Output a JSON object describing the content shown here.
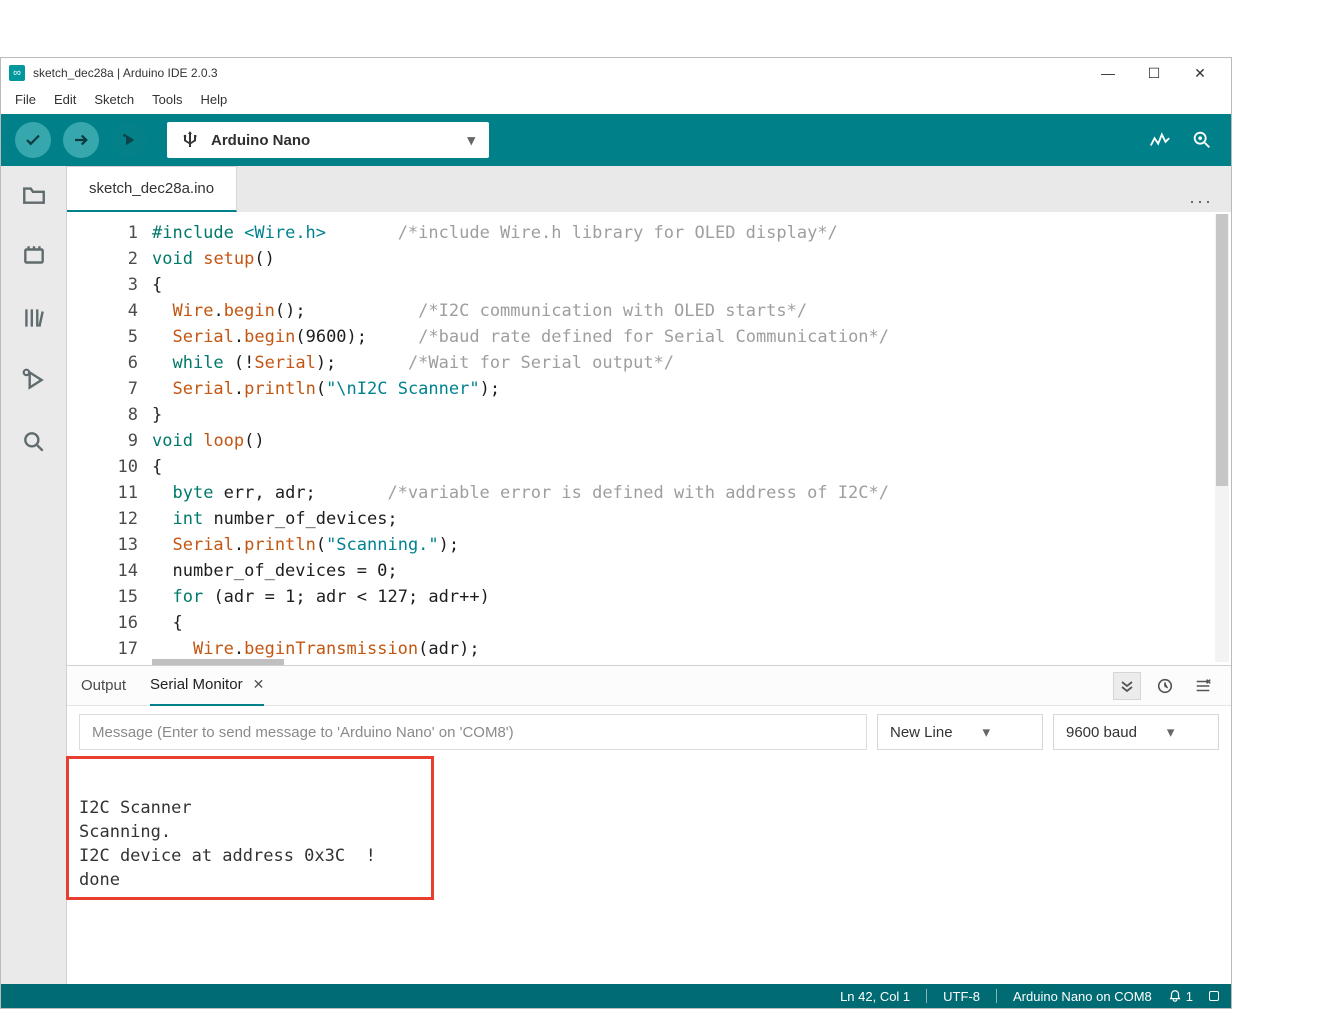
{
  "window": {
    "title": "sketch_dec28a | Arduino IDE 2.0.3"
  },
  "menu": [
    "File",
    "Edit",
    "Sketch",
    "Tools",
    "Help"
  ],
  "board_selector": {
    "label": "Arduino Nano"
  },
  "tab": {
    "filename": "sketch_dec28a.ino"
  },
  "code_lines": [
    {
      "n": 1,
      "html": "<span class='kw'>#include</span> <span class='str'>&lt;Wire.h&gt;</span>       <span class='cmt'>/*include Wire.h library for OLED display*/</span>"
    },
    {
      "n": 2,
      "html": "<span class='kw'>void</span> <span class='fn'>setup</span>()"
    },
    {
      "n": 3,
      "html": "{"
    },
    {
      "n": 4,
      "html": "  <span class='fn'>Wire</span>.<span class='fn'>begin</span>();           <span class='cmt'>/*I2C communication with OLED starts*/</span>"
    },
    {
      "n": 5,
      "html": "  <span class='fn'>Serial</span>.<span class='fn'>begin</span>(<span class='num'>9600</span>);     <span class='cmt'>/*baud rate defined for Serial Communication*/</span>"
    },
    {
      "n": 6,
      "html": "  <span class='kw'>while</span> (!<span class='fn'>Serial</span>);       <span class='cmt'>/*Wait for Serial output*/</span>"
    },
    {
      "n": 7,
      "html": "  <span class='fn'>Serial</span>.<span class='fn'>println</span>(<span class='str'>\"\\nI2C Scanner\"</span>);"
    },
    {
      "n": 8,
      "html": "}"
    },
    {
      "n": 9,
      "html": "<span class='kw'>void</span> <span class='fn'>loop</span>()"
    },
    {
      "n": 10,
      "html": "{"
    },
    {
      "n": 11,
      "html": "  <span class='kw'>byte</span> err, adr;       <span class='cmt'>/*variable error is defined with address of I2C*/</span>"
    },
    {
      "n": 12,
      "html": "  <span class='kw'>int</span> number_of_devices;"
    },
    {
      "n": 13,
      "html": "  <span class='fn'>Serial</span>.<span class='fn'>println</span>(<span class='str'>\"Scanning.\"</span>);"
    },
    {
      "n": 14,
      "html": "  number_of_devices = <span class='num'>0</span>;"
    },
    {
      "n": 15,
      "html": "  <span class='kw'>for</span> (adr = <span class='num'>1</span>; adr &lt; <span class='num'>127</span>; adr++)"
    },
    {
      "n": 16,
      "html": "  {"
    },
    {
      "n": 17,
      "html": "    <span class='fn'>Wire</span>.<span class='fn'>beginTransmission</span>(adr);"
    }
  ],
  "bottom_panel": {
    "tabs": {
      "output": "Output",
      "serial": "Serial Monitor"
    },
    "message_placeholder": "Message (Enter to send message to 'Arduino Nano' on 'COM8')",
    "line_ending": "New Line",
    "baud": "9600 baud",
    "serial_output": "\nI2C Scanner\nScanning.\nI2C device at address 0x3C  !\ndone"
  },
  "statusbar": {
    "cursor": "Ln 42, Col 1",
    "encoding": "UTF-8",
    "board": "Arduino Nano on COM8",
    "notif_count": "1"
  }
}
